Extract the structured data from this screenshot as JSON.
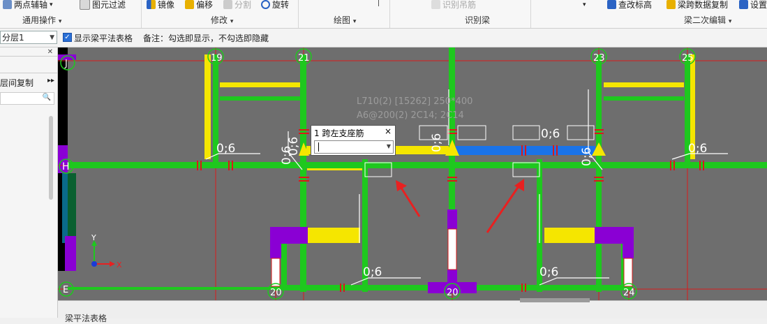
{
  "ribbon": {
    "groups": [
      {
        "label": "通用操作",
        "items": [
          "两点辅轴",
          "图元过滤"
        ]
      },
      {
        "label": "修改",
        "items": [
          "镜像",
          "偏移",
          "分割",
          "旋转"
        ]
      },
      {
        "label": "绘图",
        "items": []
      },
      {
        "label": "识别梁",
        "items": [
          "识别吊筋"
        ]
      },
      {
        "label": "梁二次编辑",
        "items": [
          "查改标高",
          "梁跨数据复制",
          "设置"
        ]
      }
    ]
  },
  "toolbar": {
    "floor": "分层1",
    "show_table_checkbox": true,
    "show_table_label": "显示梁平法表格",
    "note": "备注：勾选即显示，不勾选即隐藏"
  },
  "left_panel": {
    "item": "层间复制"
  },
  "canvas": {
    "axis_labels": [
      "19",
      "21",
      "23",
      "25",
      "20",
      "20",
      "24",
      "J",
      "H",
      "E"
    ],
    "dim_labels": [
      "0;6",
      "0;6",
      "0;6",
      "0;6",
      "0;6",
      "0;6",
      "0;6",
      "0;6",
      "0;6"
    ],
    "annotation_line1": "L710(2) [15262] 250*400",
    "annotation_line2": "A6@200(2) 2C14; 2C14",
    "axis_y": "Y",
    "axis_x": "X"
  },
  "popup": {
    "title": "1 跨左支座筋",
    "close": "×",
    "value": ""
  },
  "bottom": {
    "title": "梁平法表格"
  }
}
